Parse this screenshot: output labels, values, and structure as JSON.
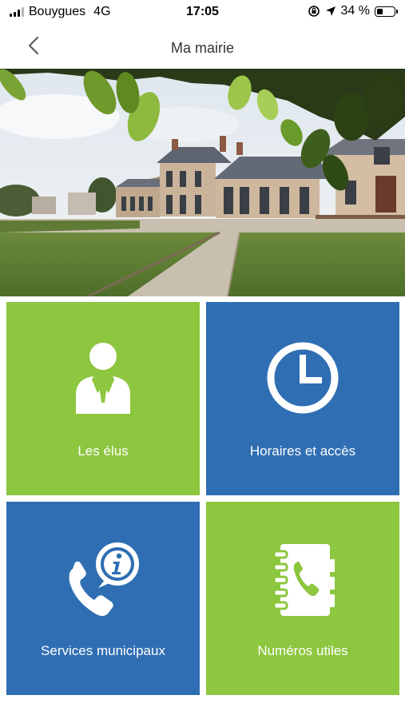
{
  "status_bar": {
    "carrier": "Bouygues",
    "network": "4G",
    "time": "17:05",
    "battery_text": "34 %",
    "battery_level": 0.34,
    "icons": [
      "signal-icon",
      "orientation-lock-icon",
      "location-arrow-icon",
      "battery-icon"
    ]
  },
  "header": {
    "title": "Ma mairie",
    "back_icon": "chevron-left-icon"
  },
  "hero": {
    "description_icon": "town-hall-photo"
  },
  "colors": {
    "green": "#8dc63f",
    "blue": "#2f6eb3",
    "white": "#ffffff"
  },
  "tiles": [
    {
      "label": "Les élus",
      "icon": "elected-official-icon",
      "color": "#8dc63f"
    },
    {
      "label": "Horaires et accès",
      "icon": "clock-icon",
      "color": "#2f6eb3"
    },
    {
      "label": "Services municipaux",
      "icon": "phone-info-icon",
      "color": "#2f6eb3"
    },
    {
      "label": "Numéros utiles",
      "icon": "phone-book-icon",
      "color": "#8dc63f"
    }
  ]
}
